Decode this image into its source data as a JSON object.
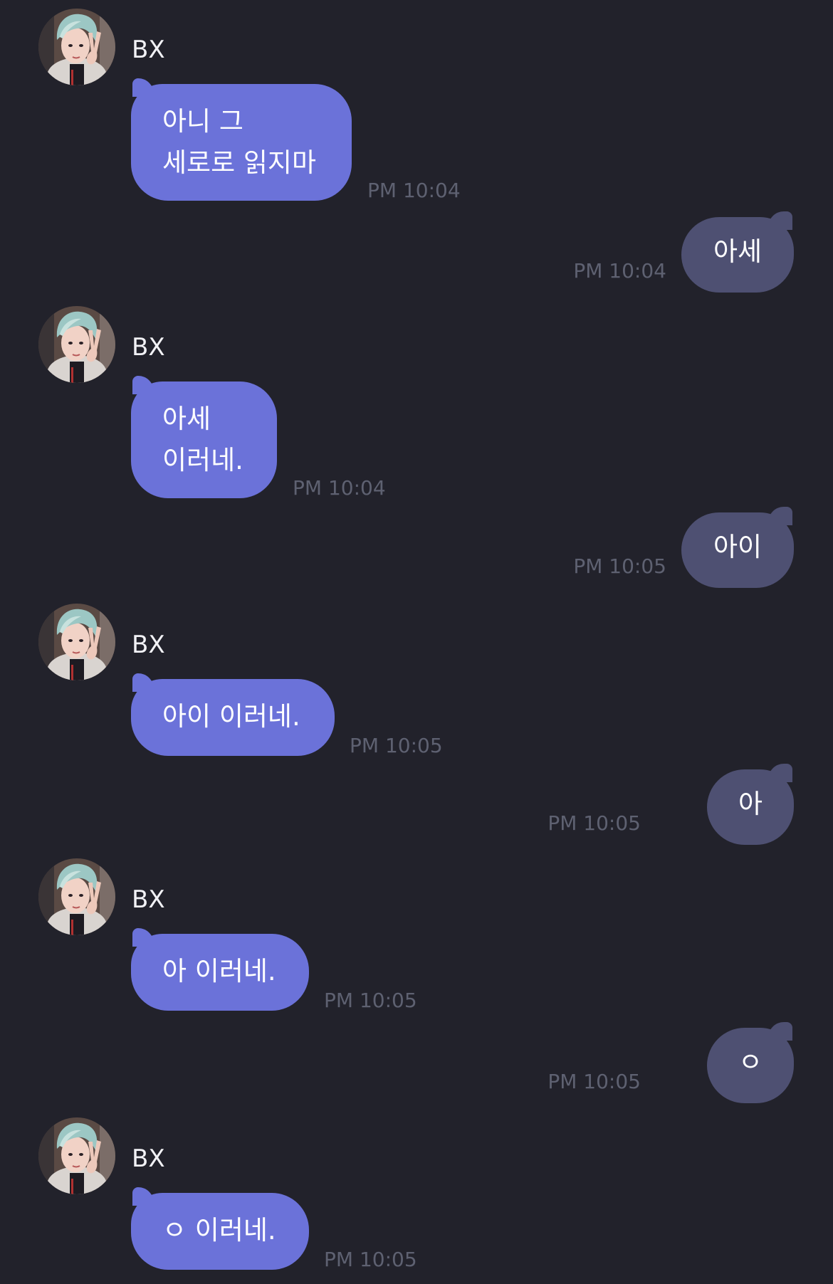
{
  "contact": {
    "name": "BX"
  },
  "messages": [
    {
      "side": "in",
      "text": "아니 그\n세로로 읽지마",
      "time": "PM 10:04"
    },
    {
      "side": "out",
      "text": "아세",
      "time": "PM 10:04"
    },
    {
      "side": "in",
      "text": "아세\n이러네.",
      "time": "PM 10:04"
    },
    {
      "side": "out",
      "text": "아이",
      "time": "PM 10:05"
    },
    {
      "side": "in",
      "text": "아이 이러네.",
      "time": "PM 10:05"
    },
    {
      "side": "out",
      "text": "아",
      "time": "PM 10:05"
    },
    {
      "side": "in",
      "text": "아 이러네.",
      "time": "PM 10:05"
    },
    {
      "side": "out",
      "text": "ㅇ",
      "time": "PM 10:05"
    },
    {
      "side": "in",
      "text": "ㅇ 이러네.",
      "time": "PM 10:05"
    }
  ],
  "colors": {
    "background": "#22222b",
    "incoming_bubble": "#6b72d9",
    "outgoing_bubble": "#4e5072",
    "timestamp": "#5e6171"
  }
}
